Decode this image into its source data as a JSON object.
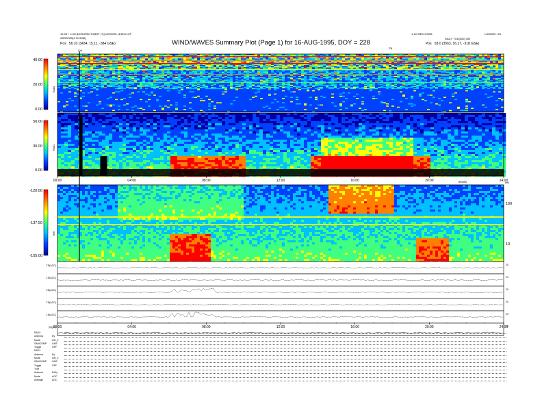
{
  "header": {
    "tl_line1": "19-03 + 1:08 [DOSSPACT\\08GF (7)] \\2/03/\\95\\ 11/8/\\C1GF",
    "tl_line2": "ASSSF6B(3 3\\13/08(",
    "tr_line1": "1.10 WED 2/3/08",
    "tr_line2": "LO00000 r.01",
    "tr_line3": "DAILY TOD[300] 300",
    "pos_left_label": "Pos",
    "pos_left": "56.10 (3434, 15.11, -384 GSE)",
    "pos_right_label": "Pos",
    "pos_right": "58.0 (3563, 16.17, -318 GSE)",
    "title": "WIND/WAVES Summary Plot (Page 1) for 16-AUG-1995, DOY = 228",
    "mark_c": "Cal",
    "mark_tb": "TB",
    "mark_tr": "TB3003"
  },
  "panels": {
    "rad2": {
      "label": "RAD2",
      "ticks": [
        "40.00",
        "20.00",
        "0.00"
      ]
    },
    "rad1": {
      "label": "RAD1",
      "ticks": [
        "50.00",
        "30.00",
        "0.00"
      ]
    },
    "tnr": {
      "label": "TNR",
      "ticks": [
        "-120.00",
        "-137.50",
        "-155.00"
      ],
      "right_ticks": [
        "100",
        "10"
      ],
      "right_unit": "kHz"
    }
  },
  "time_axis": {
    "labels": [
      "00:00",
      "04:00",
      "08:00",
      "12:00",
      "16:00",
      "20:00",
      "24:00"
    ],
    "marker": "BRXBB",
    "unit_label": "kHz"
  },
  "line_panels": [
    {
      "label": "ΣE(AGC)",
      "right": "20"
    },
    {
      "label": "ΣE(AGC)",
      "right": "20"
    },
    {
      "label": "ΣE(AGC)",
      "right": "20"
    },
    {
      "label": "ΣE(AGC)",
      "right": "20"
    },
    {
      "label": "ΣE(AGC)",
      "right": "20"
    },
    {
      "label": "|B|(nT)",
      "right": "15"
    }
  ],
  "footer": [
    {
      "k": "RAD2",
      "v": ""
    },
    {
      "k": "Antenna",
      "v": "Ey"
    },
    {
      "k": "Mode",
      "v": "LIN_0"
    },
    {
      "k": "SAMCOMP",
      "v": "LINE"
    },
    {
      "k": "Toggle",
      "v": "OFF"
    },
    {
      "k": "RAD1",
      "v": ""
    },
    {
      "k": "Antenna",
      "v": "Ey"
    },
    {
      "k": "Mode",
      "v": "LIN_0"
    },
    {
      "k": "SAMCOMP",
      "v": "LINE"
    },
    {
      "k": "Toggle",
      "v": "OFF"
    },
    {
      "k": "TNR",
      "v": ""
    },
    {
      "k": "Antenna",
      "v": "ExEy"
    },
    {
      "k": "Mode",
      "v": "AGC"
    },
    {
      "k": "Average",
      "v": "AGC"
    }
  ],
  "colors": {
    "scale": [
      "#0000a0",
      "#0040ff",
      "#00c0ff",
      "#40ff80",
      "#ffff00",
      "#ff8000",
      "#ff0000"
    ]
  },
  "chart_data": {
    "type": "heatmap",
    "title": "WIND/WAVES Summary Plot (Page 1) for 16-AUG-1995, DOY = 228",
    "xlabel": "UT",
    "x_range": [
      "00:00",
      "24:00"
    ],
    "series": [
      {
        "name": "RAD2",
        "ylim": [
          0,
          40
        ]
      },
      {
        "name": "RAD1",
        "ylim": [
          0,
          50
        ]
      },
      {
        "name": "TNR",
        "ylim": [
          -155,
          -120
        ]
      }
    ]
  }
}
